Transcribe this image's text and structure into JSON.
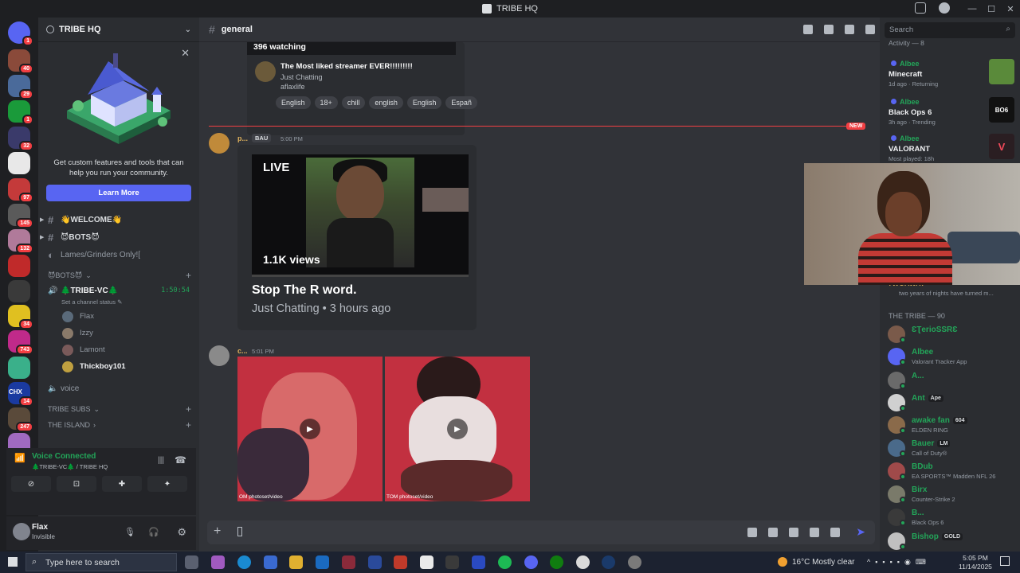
{
  "window": {
    "title": "TRIBE HQ"
  },
  "servers": [
    {
      "badge": "1",
      "color": "#5865f2",
      "icon": "discord-home-icon"
    },
    {
      "badge": "40",
      "color": "#8a4a3a"
    },
    {
      "badge": "29",
      "color": "#4a6a9a"
    },
    {
      "badge": "1",
      "color": "#1a9a3a"
    },
    {
      "badge": "32",
      "color": "#3a3a6a"
    },
    {
      "badge": "",
      "color": "#e8e8e8"
    },
    {
      "badge": "97",
      "color": "#c43a3a"
    },
    {
      "badge": "145",
      "color": "#5a5a5a"
    },
    {
      "badge": "132",
      "color": "#b07a9a"
    },
    {
      "badge": "",
      "color": "#c02a2a"
    },
    {
      "badge": "",
      "color": "#3a3a3a"
    },
    {
      "badge": "34",
      "color": "#e0c020"
    },
    {
      "badge": "743",
      "color": "#c02a8a"
    },
    {
      "badge": "",
      "color": "#3ab08a"
    },
    {
      "badge": "14",
      "color": "#1a3aa0",
      "label": "CHX"
    },
    {
      "badge": "247",
      "color": "#5a4a3a"
    },
    {
      "badge": "",
      "color": "#a06ac0"
    }
  ],
  "sidebar": {
    "server_name": "TRIBE HQ",
    "promo_text": "Get custom features and tools that can help you run your community.",
    "learn_more": "Learn More",
    "channels": [
      {
        "name": "👋WELCOME👋",
        "bright": true
      },
      {
        "name": "😈BOTS😈",
        "bright": true
      },
      {
        "name": "Lames/Grinders Only![",
        "bright": false
      }
    ],
    "category_bots": "😈BOTS😈",
    "voice_channel": "🌲TRIBE-VC🌲",
    "voice_timer": "1:50:54",
    "channel_status_prompt": "Set a channel status",
    "voice_members": [
      "Flax",
      "Izzy",
      "Lamont",
      "Thickboy101"
    ],
    "voice_channel_2": "voice",
    "category_subs": "TRIBE SUBS",
    "island": "THE ISLAND"
  },
  "voice_panel": {
    "status": "Voice Connected",
    "location": "🌲TRIBE-VC🌲 / TRIBE HQ"
  },
  "user": {
    "name": "Flax",
    "status": "Invisible"
  },
  "chat": {
    "channel": "general",
    "embed1": {
      "watching": "396 watching",
      "title": "The Most liked streamer EVER!!!!!!!!!",
      "category": "Just Chatting",
      "username": "aflaxlife",
      "tags": [
        "English",
        "18+",
        "chill",
        "english",
        "English",
        "Españ"
      ]
    },
    "new_badge": "NEW",
    "msg1": {
      "author": "p...",
      "role": "BAU",
      "time": "5:00 PM"
    },
    "embed2": {
      "live": "LIVE",
      "views": "1.1K views",
      "title": "Stop The R word.",
      "subtitle": "Just Chatting • 3 hours ago"
    },
    "msg2": {
      "author": "c...",
      "time": "5:01 PM"
    },
    "media": [
      {
        "caption": "OM photoset/video"
      },
      {
        "caption": "TOM photoset/video"
      }
    ]
  },
  "members": {
    "search_placeholder": "Search",
    "activity_header": "Activity — 8",
    "activities": [
      {
        "name": "Albee",
        "game": "Minecraft",
        "meta": "1d ago · Returning",
        "color": "#5a8a3a"
      },
      {
        "name": "Albee",
        "game": "Black Ops 6",
        "meta": "3h ago · Trending",
        "color": "#111111"
      },
      {
        "name": "Albee",
        "game": "VALORANT",
        "meta": "Most played: 18h",
        "color": "#2a1e22"
      }
    ],
    "streamer_line": "two years of nights have turned m...",
    "streamer_name": "TWOAWAY",
    "category": "THE TRIBE — 90",
    "list": [
      {
        "name": "ƐƮerioSSRƐ",
        "status": "",
        "tag": "",
        "color": "#7a5a4a"
      },
      {
        "name": "Albee",
        "status": "Valorant Tracker App",
        "tag": "",
        "color": "#5865f2"
      },
      {
        "name": "A...",
        "status": "",
        "tag": "",
        "color": "#6a6a6a"
      },
      {
        "name": "Ant",
        "status": "",
        "tag": "Ape",
        "color": "#d0d0d0"
      },
      {
        "name": "awake fan",
        "status": "ELDEN RING",
        "tag": "604",
        "color": "#8a6a4a"
      },
      {
        "name": "Bauer",
        "status": "Call of Duty®",
        "tag": "LM",
        "color": "#4a6a8a"
      },
      {
        "name": "BDub",
        "status": "EA SPORTS™ Madden NFL 26",
        "tag": "",
        "color": "#a04a4a"
      },
      {
        "name": "Birx",
        "status": "Counter-Strike 2",
        "tag": "",
        "color": "#7a7a6a"
      },
      {
        "name": "B...",
        "status": "Black Ops 6",
        "tag": "",
        "color": "#3a3a3a"
      },
      {
        "name": "Bishop",
        "status": "",
        "tag": "GOLD",
        "color": "#c0c0c0"
      }
    ]
  },
  "taskbar": {
    "search_placeholder": "Type here to search",
    "weather": "16°C  Mostly clear",
    "time": "5:05 PM",
    "date": "11/14/2025"
  }
}
